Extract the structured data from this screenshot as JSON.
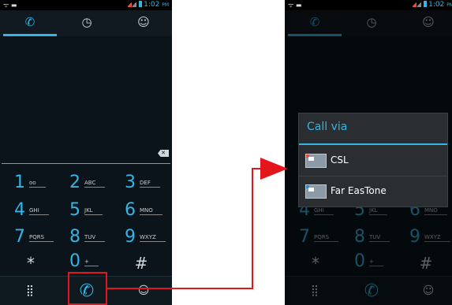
{
  "status": {
    "time": "1:02",
    "ampm": "PM"
  },
  "tabs": [
    {
      "name": "phone-icon",
      "glyph": "✆",
      "selected": true
    },
    {
      "name": "clock-icon",
      "glyph": "◷",
      "selected": false
    },
    {
      "name": "contact-icon",
      "glyph": "☺",
      "selected": false
    }
  ],
  "keypad": [
    {
      "digit": "1",
      "sub": "oo"
    },
    {
      "digit": "2",
      "sub": "ABC"
    },
    {
      "digit": "3",
      "sub": "DEF"
    },
    {
      "digit": "4",
      "sub": "GHI"
    },
    {
      "digit": "5",
      "sub": "JKL"
    },
    {
      "digit": "6",
      "sub": "MNO"
    },
    {
      "digit": "7",
      "sub": "PQRS"
    },
    {
      "digit": "8",
      "sub": "TUV"
    },
    {
      "digit": "9",
      "sub": "WXYZ"
    },
    {
      "digit": "*",
      "sub": ""
    },
    {
      "digit": "0",
      "sub": "+"
    },
    {
      "digit": "#",
      "sub": ""
    }
  ],
  "bottom": {
    "dialpad_glyph": "⣿",
    "call_glyph": "✆",
    "add_contact_glyph": "☺"
  },
  "dialog": {
    "title": "Call via",
    "options": [
      {
        "label": "CSL"
      },
      {
        "label": "Far EasTone"
      }
    ]
  },
  "colors": {
    "accent": "#33b5e5",
    "arrow": "#e2161b"
  }
}
